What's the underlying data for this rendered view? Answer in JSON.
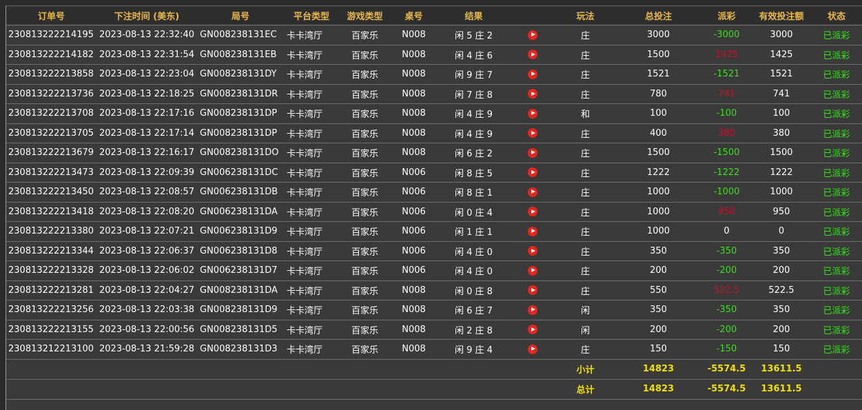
{
  "headers": [
    "订单号",
    "下注时间 (美东)",
    "局号",
    "平台类型",
    "游戏类型",
    "桌号",
    "结果",
    "",
    "玩法",
    "总投注",
    "派彩",
    "有效投注额",
    "状态"
  ],
  "rows": [
    {
      "order": "230813222214195",
      "time": "2023-08-13 22:32:40",
      "round": "GN008238131EC",
      "platform": "卡卡湾厅",
      "game": "百家乐",
      "table": "N008",
      "result": "闲 5 庄 2",
      "play": "庄",
      "bet": "3000",
      "payout": "-3000",
      "payout_type": "neg",
      "valid": "3000",
      "status": "已派彩"
    },
    {
      "order": "230813222214182",
      "time": "2023-08-13 22:31:54",
      "round": "GN008238131EB",
      "platform": "卡卡湾厅",
      "game": "百家乐",
      "table": "N008",
      "result": "闲 4 庄 6",
      "play": "庄",
      "bet": "1500",
      "payout": "1425",
      "payout_type": "pos",
      "valid": "1425",
      "status": "已派彩"
    },
    {
      "order": "230813222213858",
      "time": "2023-08-13 22:23:04",
      "round": "GN008238131DY",
      "platform": "卡卡湾厅",
      "game": "百家乐",
      "table": "N008",
      "result": "闲 9 庄 7",
      "play": "庄",
      "bet": "1521",
      "payout": "-1521",
      "payout_type": "neg",
      "valid": "1521",
      "status": "已派彩"
    },
    {
      "order": "230813222213736",
      "time": "2023-08-13 22:18:25",
      "round": "GN008238131DR",
      "platform": "卡卡湾厅",
      "game": "百家乐",
      "table": "N008",
      "result": "闲 7 庄 8",
      "play": "庄",
      "bet": "780",
      "payout": "741",
      "payout_type": "pos",
      "valid": "741",
      "status": "已派彩"
    },
    {
      "order": "230813222213708",
      "time": "2023-08-13 22:17:16",
      "round": "GN008238131DP",
      "platform": "卡卡湾厅",
      "game": "百家乐",
      "table": "N008",
      "result": "闲 4 庄 9",
      "play": "和",
      "bet": "100",
      "payout": "-100",
      "payout_type": "neg",
      "valid": "100",
      "status": "已派彩"
    },
    {
      "order": "230813222213705",
      "time": "2023-08-13 22:17:14",
      "round": "GN008238131DP",
      "platform": "卡卡湾厅",
      "game": "百家乐",
      "table": "N008",
      "result": "闲 4 庄 9",
      "play": "庄",
      "bet": "400",
      "payout": "380",
      "payout_type": "pos",
      "valid": "380",
      "status": "已派彩"
    },
    {
      "order": "230813222213679",
      "time": "2023-08-13 22:16:17",
      "round": "GN008238131DO",
      "platform": "卡卡湾厅",
      "game": "百家乐",
      "table": "N008",
      "result": "闲 6 庄 2",
      "play": "庄",
      "bet": "1500",
      "payout": "-1500",
      "payout_type": "neg",
      "valid": "1500",
      "status": "已派彩"
    },
    {
      "order": "230813222213473",
      "time": "2023-08-13 22:09:39",
      "round": "GN006238131DC",
      "platform": "卡卡湾厅",
      "game": "百家乐",
      "table": "N006",
      "result": "闲 8 庄 5",
      "play": "庄",
      "bet": "1222",
      "payout": "-1222",
      "payout_type": "neg",
      "valid": "1222",
      "status": "已派彩"
    },
    {
      "order": "230813222213450",
      "time": "2023-08-13 22:08:57",
      "round": "GN006238131DB",
      "platform": "卡卡湾厅",
      "game": "百家乐",
      "table": "N006",
      "result": "闲 8 庄 1",
      "play": "庄",
      "bet": "1000",
      "payout": "-1000",
      "payout_type": "neg",
      "valid": "1000",
      "status": "已派彩"
    },
    {
      "order": "230813222213418",
      "time": "2023-08-13 22:08:20",
      "round": "GN006238131DA",
      "platform": "卡卡湾厅",
      "game": "百家乐",
      "table": "N006",
      "result": "闲 0 庄 4",
      "play": "庄",
      "bet": "1000",
      "payout": "950",
      "payout_type": "pos",
      "valid": "950",
      "status": "已派彩"
    },
    {
      "order": "230813222213380",
      "time": "2023-08-13 22:07:21",
      "round": "GN006238131D9",
      "platform": "卡卡湾厅",
      "game": "百家乐",
      "table": "N006",
      "result": "闲 1 庄 1",
      "play": "庄",
      "bet": "1000",
      "payout": "0",
      "payout_type": "zero",
      "valid": "0",
      "status": "已派彩"
    },
    {
      "order": "230813222213344",
      "time": "2023-08-13 22:06:37",
      "round": "GN006238131D8",
      "platform": "卡卡湾厅",
      "game": "百家乐",
      "table": "N006",
      "result": "闲 4 庄 0",
      "play": "庄",
      "bet": "350",
      "payout": "-350",
      "payout_type": "neg",
      "valid": "350",
      "status": "已派彩"
    },
    {
      "order": "230813222213328",
      "time": "2023-08-13 22:06:02",
      "round": "GN006238131D7",
      "platform": "卡卡湾厅",
      "game": "百家乐",
      "table": "N006",
      "result": "闲 4 庄 0",
      "play": "庄",
      "bet": "200",
      "payout": "-200",
      "payout_type": "neg",
      "valid": "200",
      "status": "已派彩"
    },
    {
      "order": "230813222213281",
      "time": "2023-08-13 22:04:27",
      "round": "GN008238131DA",
      "platform": "卡卡湾厅",
      "game": "百家乐",
      "table": "N008",
      "result": "闲 0 庄 8",
      "play": "庄",
      "bet": "550",
      "payout": "522.5",
      "payout_type": "pos",
      "valid": "522.5",
      "status": "已派彩"
    },
    {
      "order": "230813222213256",
      "time": "2023-08-13 22:03:38",
      "round": "GN008238131D9",
      "platform": "卡卡湾厅",
      "game": "百家乐",
      "table": "N008",
      "result": "闲 6 庄 7",
      "play": "闲",
      "bet": "350",
      "payout": "-350",
      "payout_type": "neg",
      "valid": "350",
      "status": "已派彩"
    },
    {
      "order": "230813222213155",
      "time": "2023-08-13 22:00:56",
      "round": "GN008238131D5",
      "platform": "卡卡湾厅",
      "game": "百家乐",
      "table": "N008",
      "result": "闲 2 庄 8",
      "play": "闲",
      "bet": "200",
      "payout": "-200",
      "payout_type": "neg",
      "valid": "200",
      "status": "已派彩"
    },
    {
      "order": "230813212213100",
      "time": "2023-08-13 21:59:28",
      "round": "GN008238131D3",
      "platform": "卡卡湾厅",
      "game": "百家乐",
      "table": "N008",
      "result": "闲 9 庄 4",
      "play": "庄",
      "bet": "150",
      "payout": "-150",
      "payout_type": "neg",
      "valid": "150",
      "status": "已派彩"
    }
  ],
  "subtotal": {
    "label": "小计",
    "bet": "14823",
    "payout": "-5574.5",
    "valid": "13611.5"
  },
  "total": {
    "label": "总计",
    "bet": "14823",
    "payout": "-5574.5",
    "valid": "13611.5"
  },
  "colors": {
    "header_text": "#e8b84a",
    "negative": "#3ddc1f",
    "positive": "#c8102e",
    "summary": "#f0e000",
    "status": "#3ddc1f",
    "play_icon": "#e8251d"
  }
}
